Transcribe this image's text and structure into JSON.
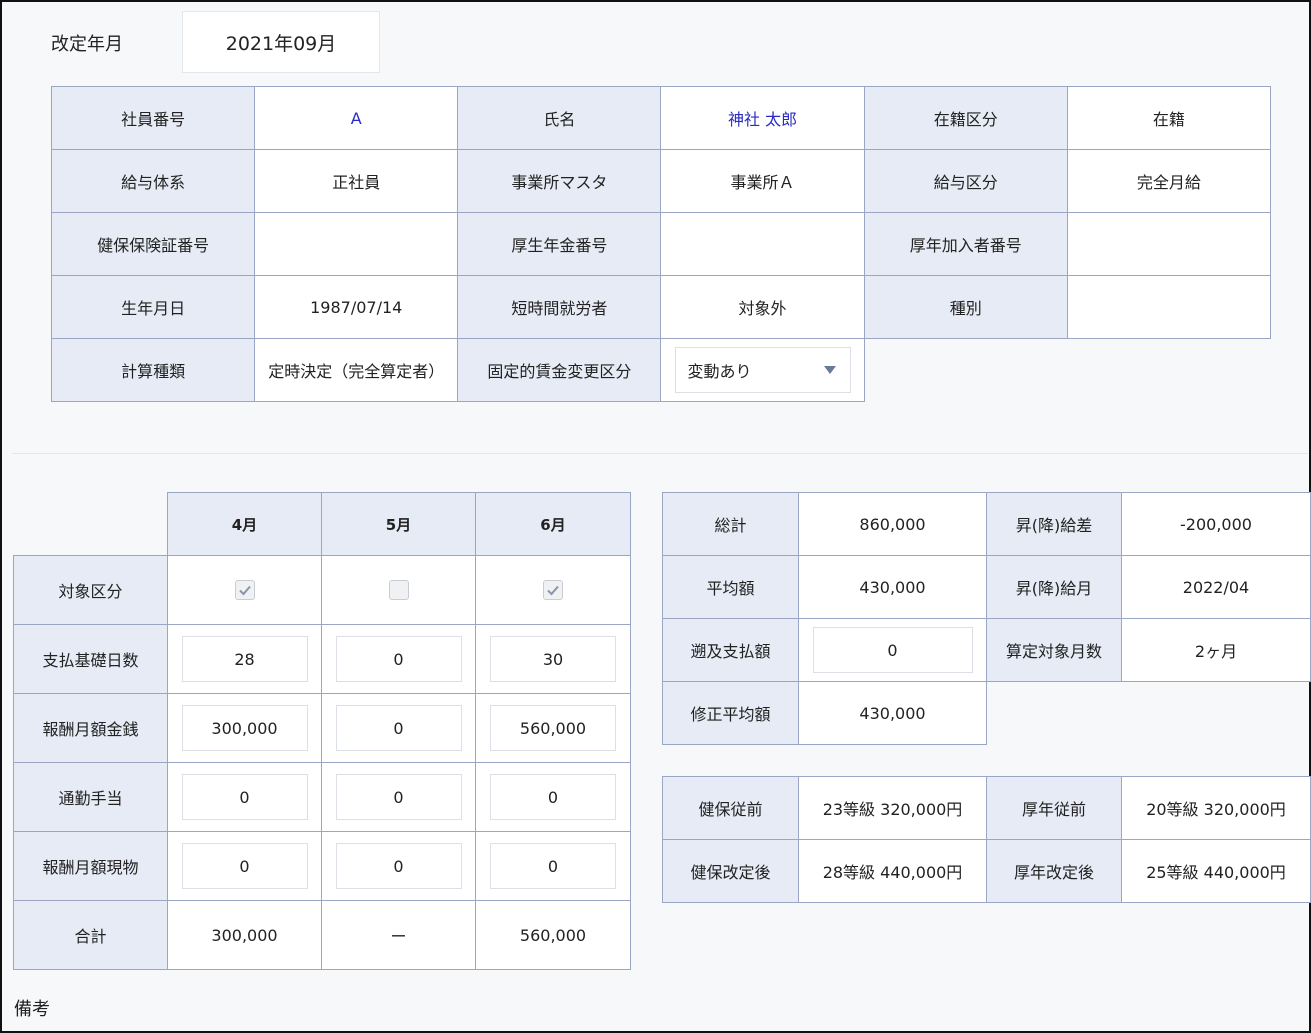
{
  "revision": {
    "label": "改定年月",
    "value": "2021年09月"
  },
  "employee": {
    "rows": [
      [
        {
          "label": "社員番号",
          "value": "A",
          "link": true
        },
        {
          "label": "氏名",
          "value": "神社 太郎",
          "link": true
        },
        {
          "label": "在籍区分",
          "value": "在籍"
        }
      ],
      [
        {
          "label": "給与体系",
          "value": "正社員"
        },
        {
          "label": "事業所マスタ",
          "value": "事業所Ａ"
        },
        {
          "label": "給与区分",
          "value": "完全月給"
        }
      ],
      [
        {
          "label": "健保保険証番号",
          "value": ""
        },
        {
          "label": "厚生年金番号",
          "value": ""
        },
        {
          "label": "厚年加入者番号",
          "value": ""
        }
      ],
      [
        {
          "label": "生年月日",
          "value": "1987/07/14"
        },
        {
          "label": "短時間就労者",
          "value": "対象外"
        },
        {
          "label": "種別",
          "value": ""
        }
      ]
    ],
    "calc_type": {
      "label": "計算種類",
      "value": "定時決定（完全算定者）"
    },
    "fixed_wage": {
      "label": "固定的賃金変更区分",
      "selected": "変動あり"
    }
  },
  "monthly": {
    "months": [
      "4月",
      "5月",
      "6月"
    ],
    "target": {
      "label": "対象区分",
      "checked": [
        true,
        false,
        true
      ]
    },
    "days": {
      "label": "支払基礎日数",
      "values": [
        "28",
        "0",
        "30"
      ]
    },
    "cash": {
      "label": "報酬月額金銭",
      "values": [
        "300,000",
        "0",
        "560,000"
      ]
    },
    "commute": {
      "label": "通勤手当",
      "values": [
        "0",
        "0",
        "0"
      ]
    },
    "inkind": {
      "label": "報酬月額現物",
      "values": [
        "0",
        "0",
        "0"
      ]
    },
    "total": {
      "label": "合計",
      "values": [
        "300,000",
        "ー",
        "560,000"
      ]
    }
  },
  "summary": {
    "grand_total": {
      "label": "総計",
      "value": "860,000"
    },
    "diff": {
      "label": "昇(降)給差",
      "value": "-200,000"
    },
    "average": {
      "label": "平均額",
      "value": "430,000"
    },
    "raise_month": {
      "label": "昇(降)給月",
      "value": "2022/04"
    },
    "retro": {
      "label": "遡及支払額",
      "value": "0"
    },
    "months_count": {
      "label": "算定対象月数",
      "value": "2ヶ月"
    },
    "adjusted_avg": {
      "label": "修正平均額",
      "value": "430,000"
    }
  },
  "grades": {
    "kenpo_before": {
      "label": "健保従前",
      "value": "23等級 320,000円"
    },
    "kounen_before": {
      "label": "厚年従前",
      "value": "20等級 320,000円"
    },
    "kenpo_after": {
      "label": "健保改定後",
      "value": "28等級 440,000円"
    },
    "kounen_after": {
      "label": "厚年改定後",
      "value": "25等級 440,000円"
    }
  },
  "remarks": {
    "label": "備考"
  }
}
